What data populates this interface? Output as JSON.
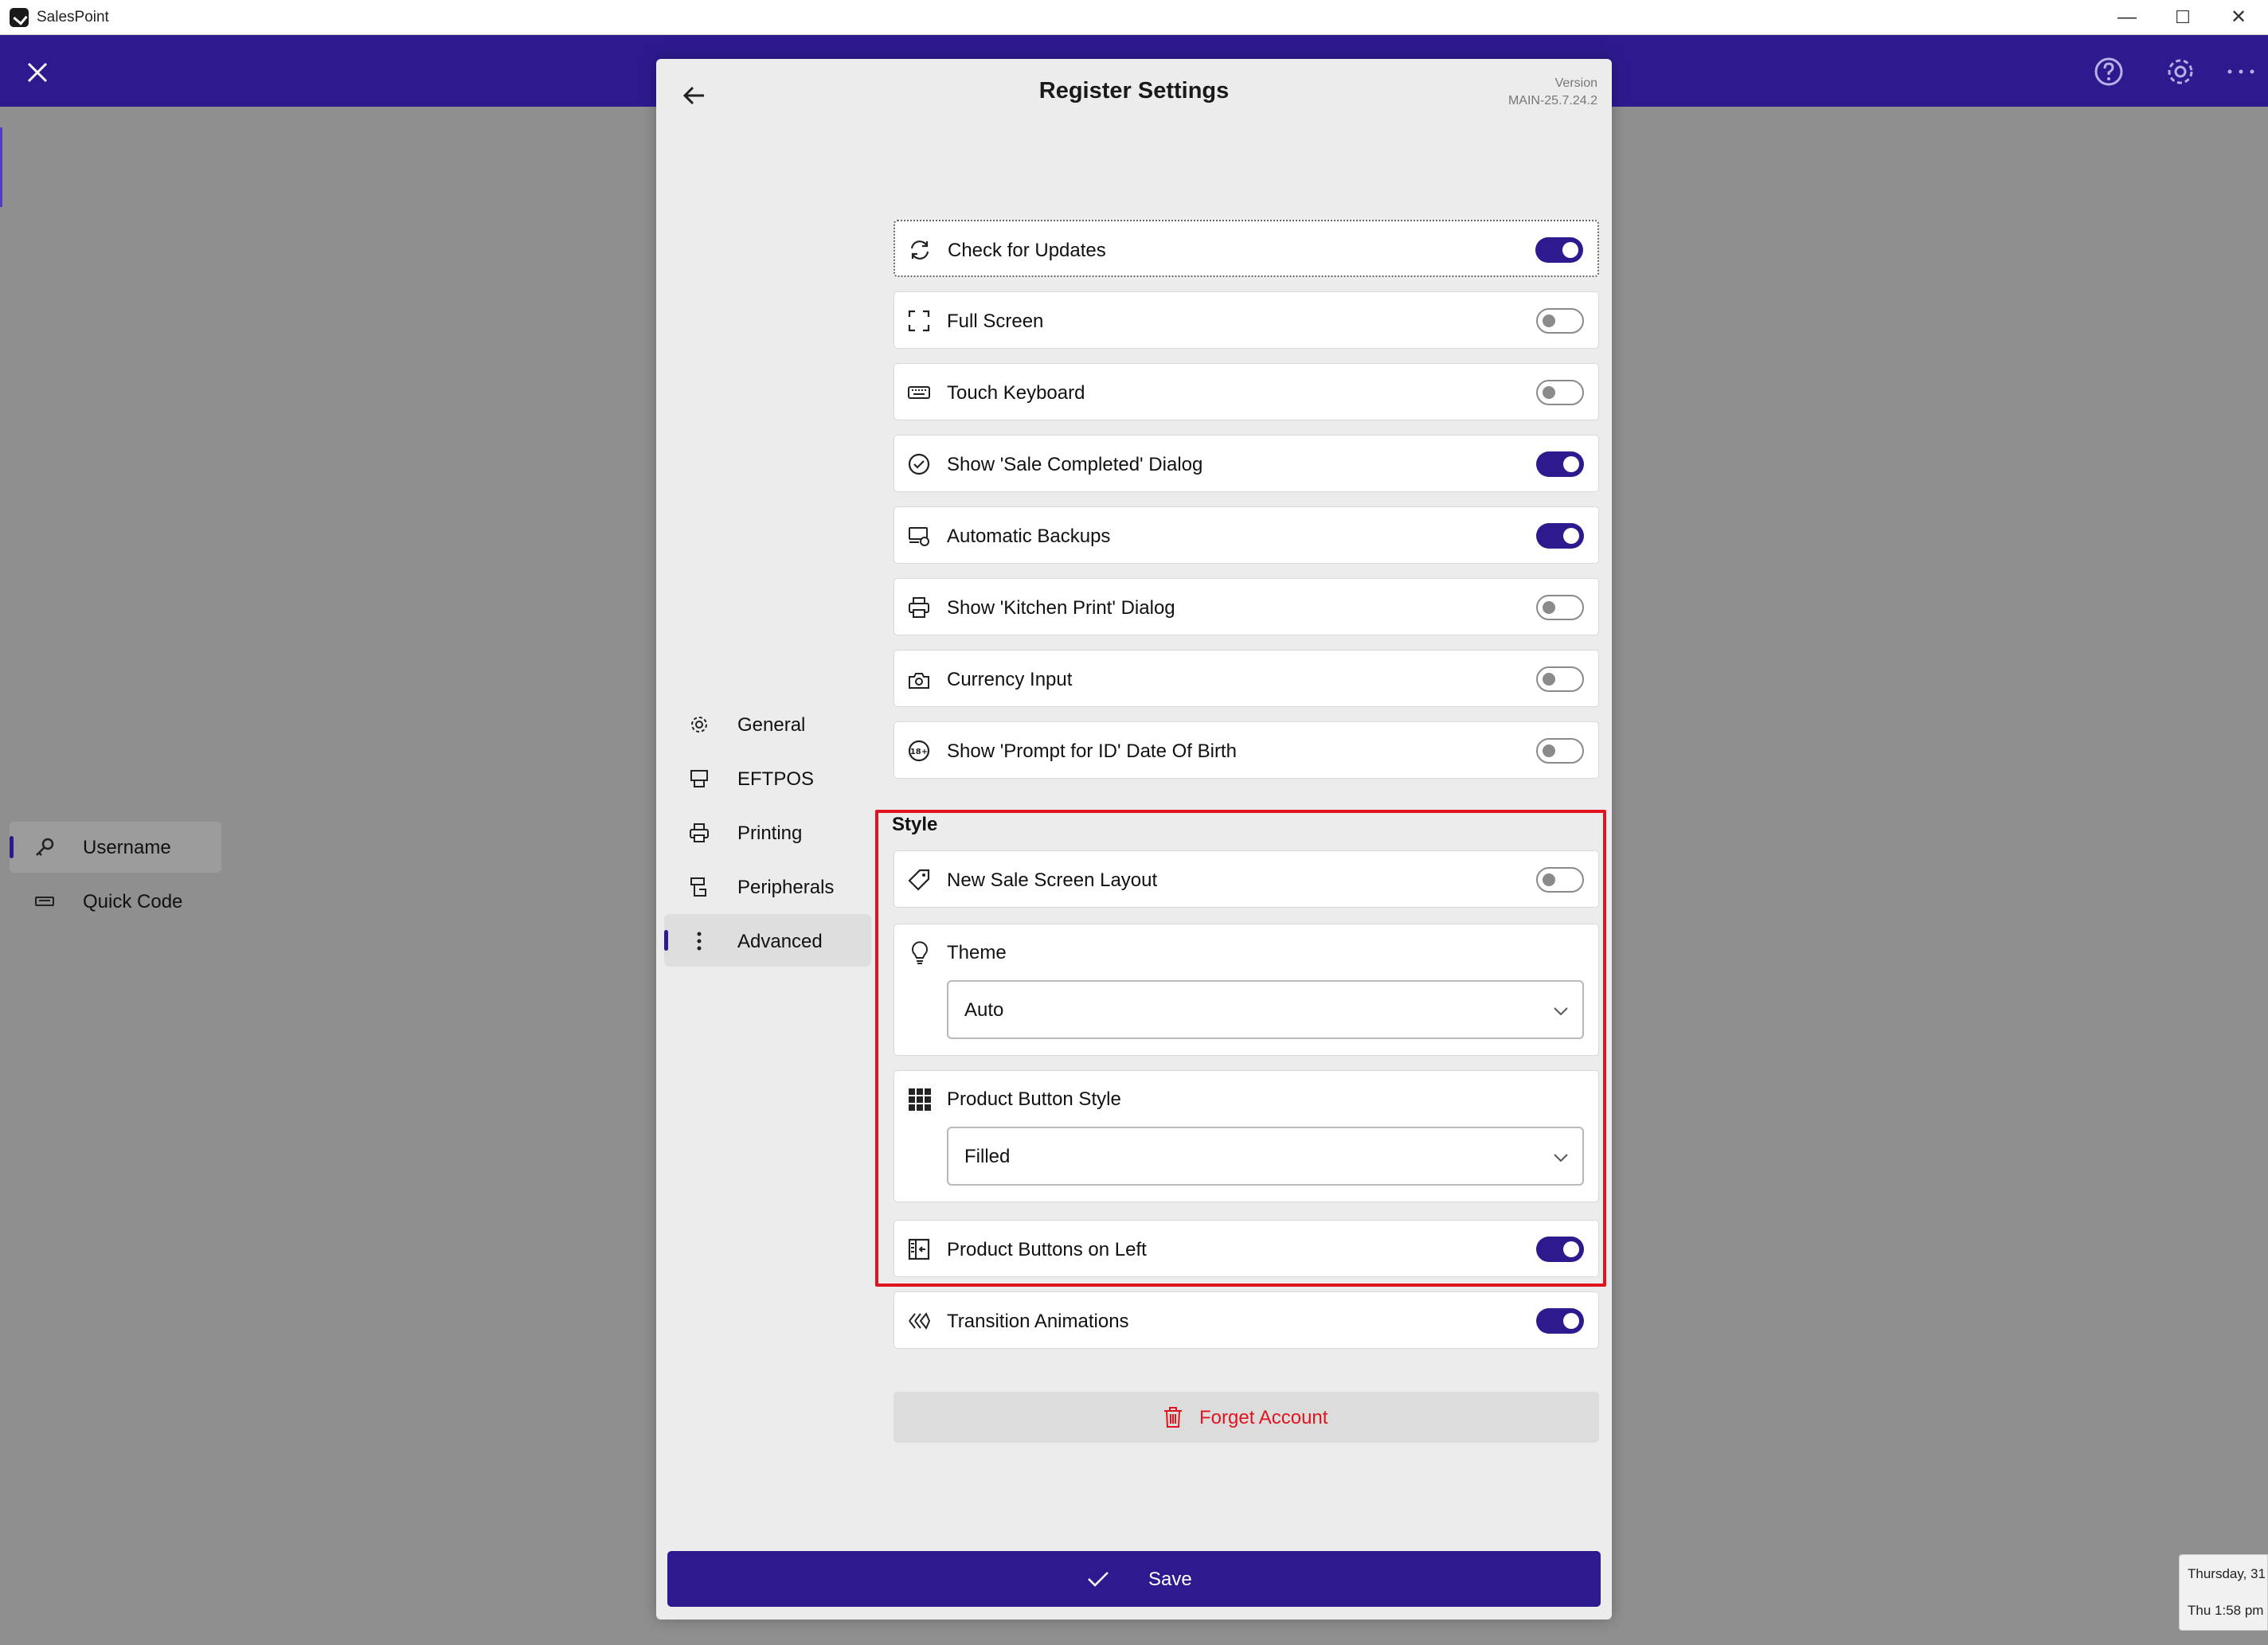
{
  "window": {
    "title": "SalesPoint",
    "minimize": "—",
    "maximize": "☐",
    "close": "✕"
  },
  "login_menu": [
    {
      "label": "Username",
      "selected": true,
      "icon": "key-icon"
    },
    {
      "label": "Quick Code",
      "selected": false,
      "icon": "keyboard-icon"
    }
  ],
  "modal": {
    "title": "Register Settings",
    "version_label": "Version",
    "version_value": "MAIN-25.7.24.2"
  },
  "nav": [
    {
      "label": "General",
      "icon": "gear-icon",
      "selected": false
    },
    {
      "label": "EFTPOS",
      "icon": "card-terminal-icon",
      "selected": false
    },
    {
      "label": "Printing",
      "icon": "printer-icon",
      "selected": false
    },
    {
      "label": "Peripherals",
      "icon": "peripherals-icon",
      "selected": false
    },
    {
      "label": "Advanced",
      "icon": "more-vertical-icon",
      "selected": true
    }
  ],
  "settings": [
    {
      "label": "Check for Updates",
      "on": true
    },
    {
      "label": "Full Screen",
      "on": false
    },
    {
      "label": "Touch Keyboard",
      "on": false
    },
    {
      "label": "Show 'Sale Completed' Dialog",
      "on": true
    },
    {
      "label": "Automatic Backups",
      "on": true
    },
    {
      "label": "Show 'Kitchen Print' Dialog",
      "on": false
    },
    {
      "label": "Currency Input",
      "on": false
    },
    {
      "label": "Show 'Prompt for ID' Date Of Birth",
      "on": false
    }
  ],
  "style": {
    "heading": "Style",
    "new_sale_layout": {
      "label": "New Sale Screen Layout",
      "on": false
    },
    "theme": {
      "label": "Theme",
      "value": "Auto"
    },
    "product_button_style": {
      "label": "Product Button Style",
      "value": "Filled"
    },
    "product_buttons_left": {
      "label": "Product Buttons on Left",
      "on": true
    }
  },
  "transition": {
    "label": "Transition Animations",
    "on": true
  },
  "forget_label": "Forget Account",
  "save_label": "Save",
  "notification": {
    "line1": "Thursday, 31",
    "line2": "Thu 1:58 pm"
  },
  "colors": {
    "accent": "#2e1a8e",
    "danger": "#e0141e"
  }
}
